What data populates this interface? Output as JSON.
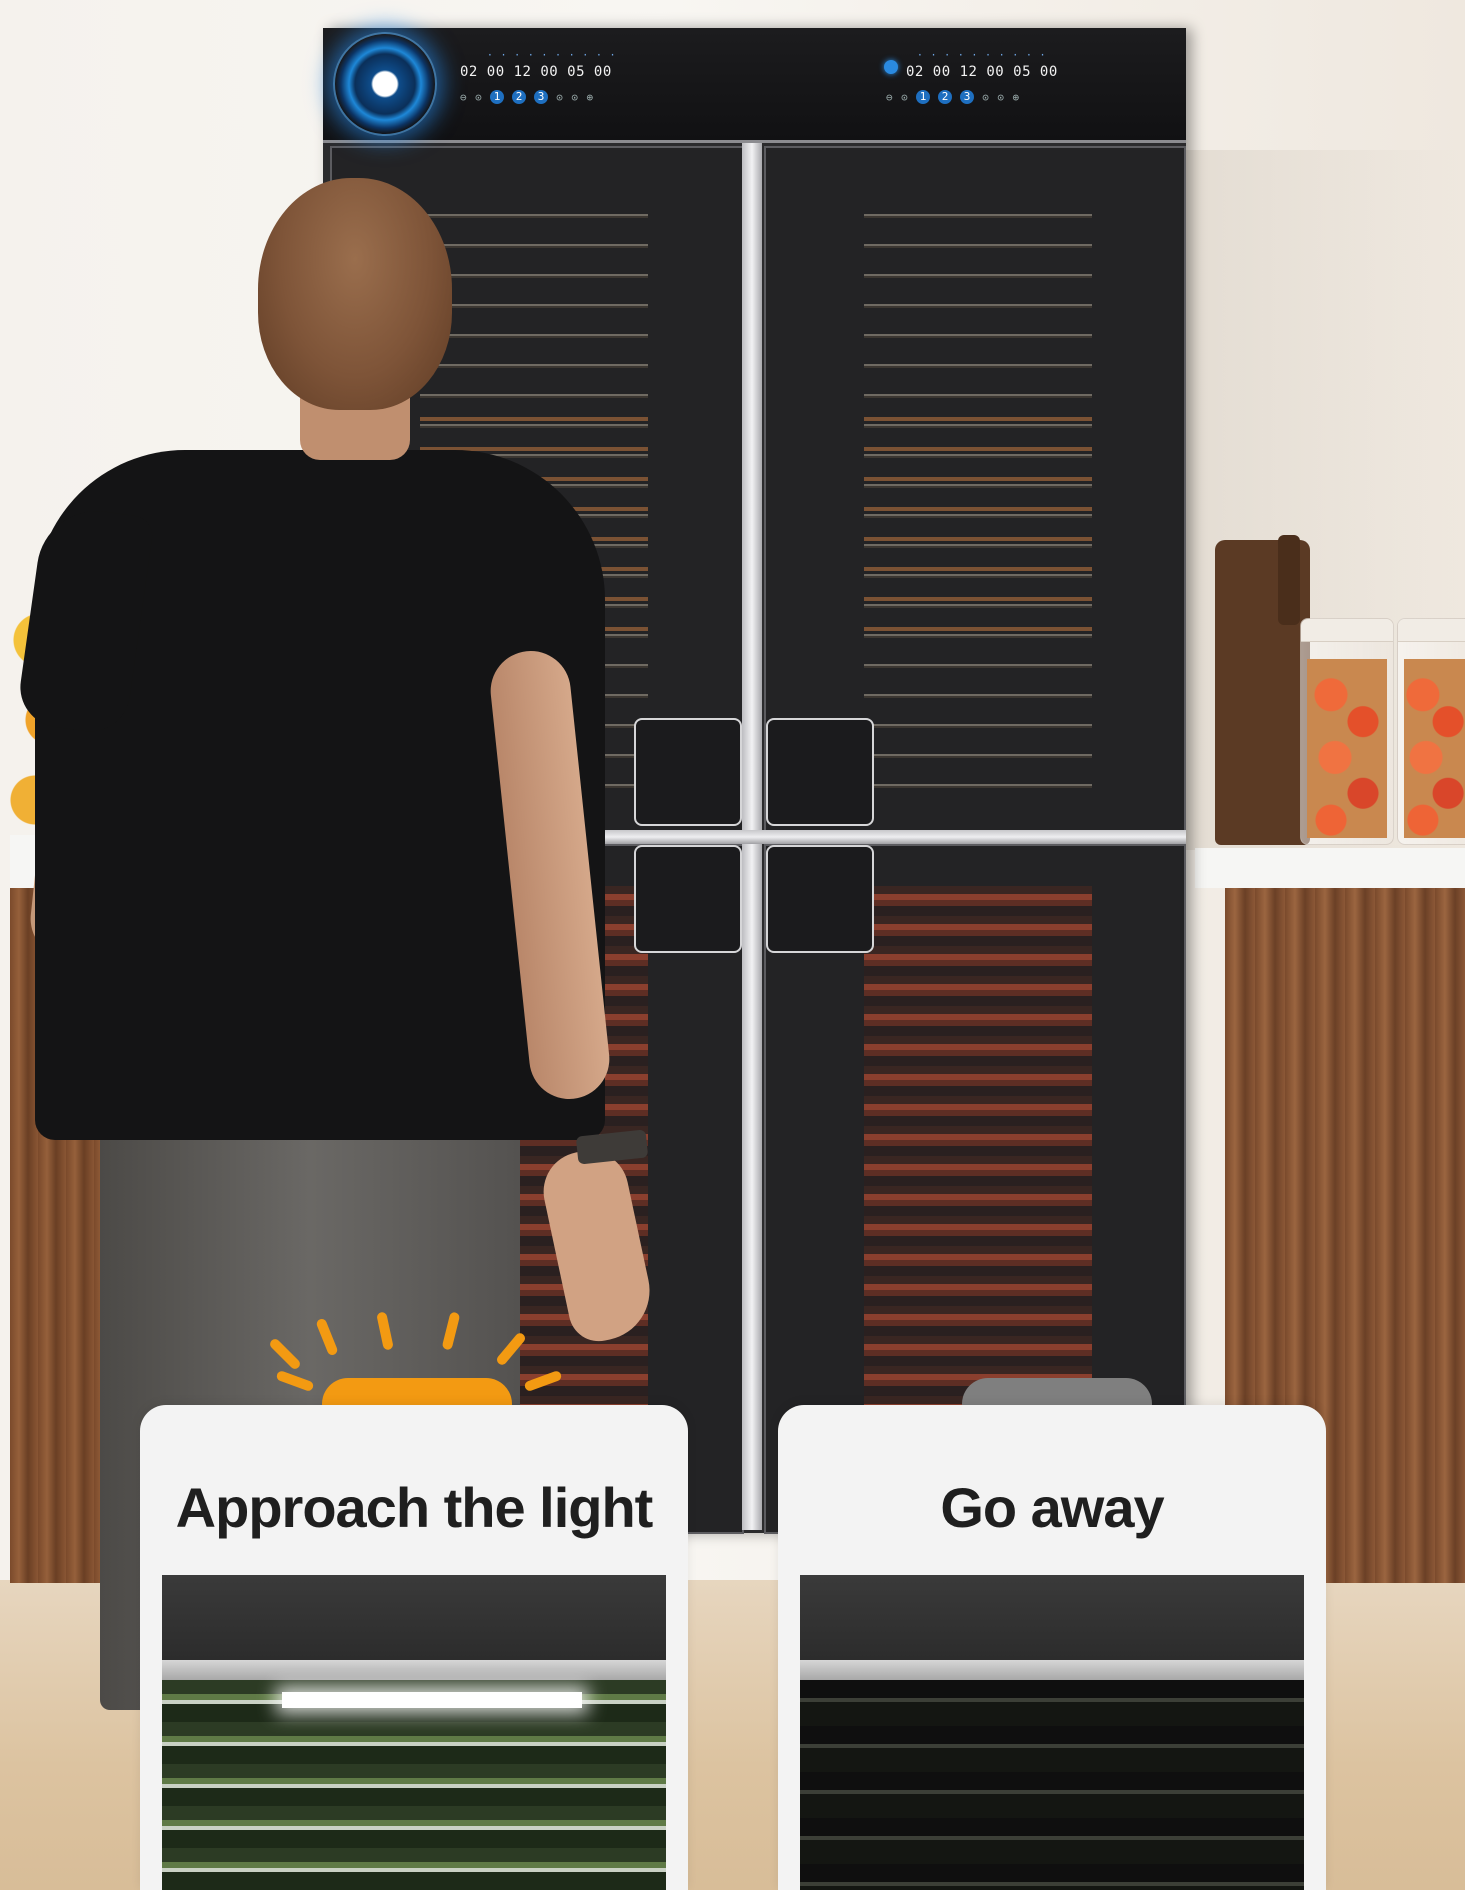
{
  "control_panel": {
    "left_display": "02 00 12 00 05 00",
    "right_display": "02 00 12 00 05 00",
    "left_keys": [
      "1",
      "2",
      "3"
    ],
    "right_keys": [
      "1",
      "2",
      "3"
    ],
    "accent_color": "#1e88d8"
  },
  "cards": [
    {
      "title": "Approach the light",
      "indicator_state": "on",
      "indicator_color": "#f39a12"
    },
    {
      "title": "Go away",
      "indicator_state": "off",
      "indicator_color": "#7f7f7f"
    }
  ]
}
